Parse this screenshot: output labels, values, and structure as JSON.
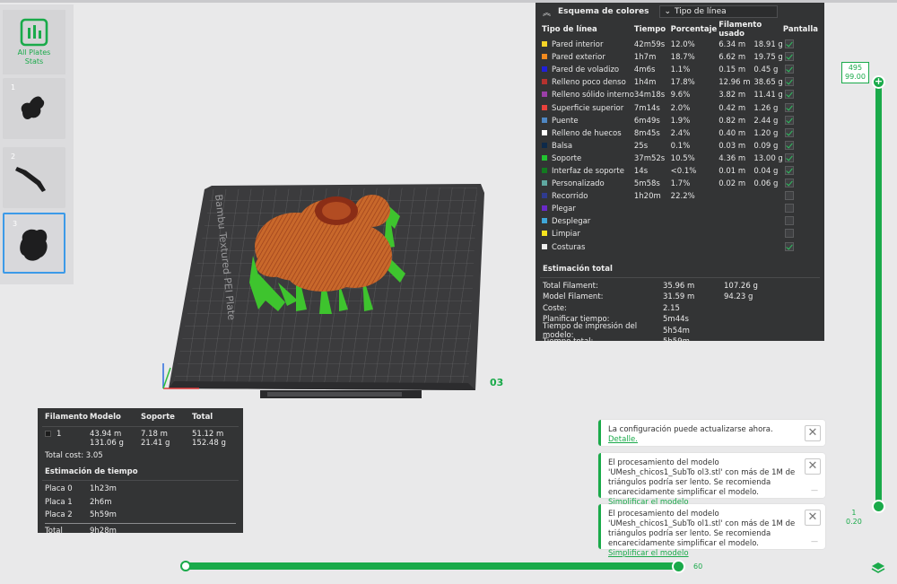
{
  "sidebar": {
    "stats_label_1": "All Plates",
    "stats_label_2": "Stats",
    "plates": [
      {
        "num": "1"
      },
      {
        "num": "2"
      },
      {
        "num": "3"
      }
    ]
  },
  "scene": {
    "bed_label": "Bambu Textured PEI Plate",
    "plate_number": "03"
  },
  "color_scheme": {
    "title": "Esquema de colores",
    "selected": "Tipo de línea",
    "headers": [
      "Tipo de línea",
      "Tiempo",
      "Porcentaje",
      "Filamento usado",
      "Pantalla"
    ],
    "rows": [
      {
        "name": "Pared interior",
        "color": "#f5d327",
        "time": "42m59s",
        "pct": "12.0%",
        "len": "6.34 m",
        "weight": "18.91 g",
        "shown": true
      },
      {
        "name": "Pared exterior",
        "color": "#f28a1f",
        "time": "1h7m",
        "pct": "18.7%",
        "len": "6.62 m",
        "weight": "19.75 g",
        "shown": true
      },
      {
        "name": "Pared de voladizo",
        "color": "#2020d8",
        "time": "4m6s",
        "pct": "1.1%",
        "len": "0.15 m",
        "weight": "0.45 g",
        "shown": true
      },
      {
        "name": "Relleno poco denso",
        "color": "#b5322e",
        "time": "1h4m",
        "pct": "17.8%",
        "len": "12.96 m",
        "weight": "38.65 g",
        "shown": true
      },
      {
        "name": "Relleno sólido interno",
        "color": "#9b3fa8",
        "time": "34m18s",
        "pct": "9.6%",
        "len": "3.82 m",
        "weight": "11.41 g",
        "shown": true
      },
      {
        "name": "Superficie superior",
        "color": "#e8413c",
        "time": "7m14s",
        "pct": "2.0%",
        "len": "0.42 m",
        "weight": "1.26 g",
        "shown": true
      },
      {
        "name": "Puente",
        "color": "#4f87c3",
        "time": "6m49s",
        "pct": "1.9%",
        "len": "0.82 m",
        "weight": "2.44 g",
        "shown": true
      },
      {
        "name": "Relleno de huecos",
        "color": "#ffffff",
        "time": "8m45s",
        "pct": "2.4%",
        "len": "0.40 m",
        "weight": "1.20 g",
        "shown": true
      },
      {
        "name": "Balsa",
        "color": "#0e2a4a",
        "time": "25s",
        "pct": "0.1%",
        "len": "0.03 m",
        "weight": "0.09 g",
        "shown": true
      },
      {
        "name": "Soporte",
        "color": "#22c330",
        "time": "37m52s",
        "pct": "10.5%",
        "len": "4.36 m",
        "weight": "13.00 g",
        "shown": true
      },
      {
        "name": "Interfaz de soporte",
        "color": "#137a20",
        "time": "14s",
        "pct": "<0.1%",
        "len": "0.01 m",
        "weight": "0.04 g",
        "shown": true
      },
      {
        "name": "Personalizado",
        "color": "#5fa8a0",
        "time": "5m58s",
        "pct": "1.7%",
        "len": "0.02 m",
        "weight": "0.06 g",
        "shown": true
      },
      {
        "name": "Recorrido",
        "color": "#2f3b8f",
        "time": "1h20m",
        "pct": "22.2%",
        "len": "",
        "weight": "",
        "shown": false
      },
      {
        "name": "Plegar",
        "color": "#6a2ac8",
        "time": "",
        "pct": "",
        "len": "",
        "weight": "",
        "shown": false
      },
      {
        "name": "Desplegar",
        "color": "#3fa6d8",
        "time": "",
        "pct": "",
        "len": "",
        "weight": "",
        "shown": false
      },
      {
        "name": "Limpiar",
        "color": "#f5e21e",
        "time": "",
        "pct": "",
        "len": "",
        "weight": "",
        "shown": false
      },
      {
        "name": "Costuras",
        "color": "#eeeeee",
        "time": "",
        "pct": "",
        "len": "",
        "weight": "",
        "shown": true
      }
    ],
    "estimation_title": "Estimación total",
    "estimation": [
      {
        "k": "Total Filament:",
        "v1": "35.96 m",
        "v2": "107.26 g"
      },
      {
        "k": "Model Filament:",
        "v1": "31.59 m",
        "v2": "94.23 g"
      },
      {
        "k": "Coste:",
        "v1": "2.15",
        "v2": ""
      },
      {
        "k": "Planificar tiempo:",
        "v1": "5m44s",
        "v2": ""
      },
      {
        "k": "Tiempo de impresión del modelo:",
        "v1": "5h54m",
        "v2": ""
      },
      {
        "k": "Tiempo total:",
        "v1": "5h59m",
        "v2": ""
      }
    ]
  },
  "filament_stats": {
    "headers": [
      "Filamento",
      "Modelo",
      "Soporte",
      "Total"
    ],
    "row": {
      "id": "1",
      "model_len": "43.94 m",
      "model_w": "131.06 g",
      "support_len": "7.18 m",
      "support_w": "21.41 g",
      "total_len": "51.12 m",
      "total_w": "152.48 g"
    },
    "total_cost_label": "Total cost:",
    "total_cost": "3.05",
    "time_title": "Estimación de tiempo",
    "times": [
      {
        "k": "Placa 0",
        "v": "1h23m"
      },
      {
        "k": "Placa 1",
        "v": "2h6m"
      },
      {
        "k": "Placa 2",
        "v": "5h59m"
      }
    ],
    "total_label": "Total",
    "total_time": "9h28m"
  },
  "notifications": {
    "n1_text": "La configuración puede actualizarse ahora.",
    "n1_link": "Detalle.",
    "n2_text": "El procesamiento del modelo 'UMesh_chicos1_SubTo ol3.stl' con más de 1M de triángulos podría ser lento. Se recomienda encarecidamente simplificar el modelo.",
    "n2_link": "Simplificar el modelo",
    "n3_text": "El procesamiento del modelo 'UMesh_chicos1_SubTo ol1.stl' con más de 1M de triángulos podría ser lento. Se recomienda encarecidamente simplificar el modelo.",
    "n3_link": "Simplificar el modelo"
  },
  "vertical_slider": {
    "top_layer": "495",
    "top_height": "99.00",
    "bottom_layer": "1",
    "bottom_height": "0.20"
  },
  "horizontal_slider": {
    "value": "60"
  },
  "colors": {
    "accent": "#1aaa4a",
    "panel": "#333435"
  }
}
